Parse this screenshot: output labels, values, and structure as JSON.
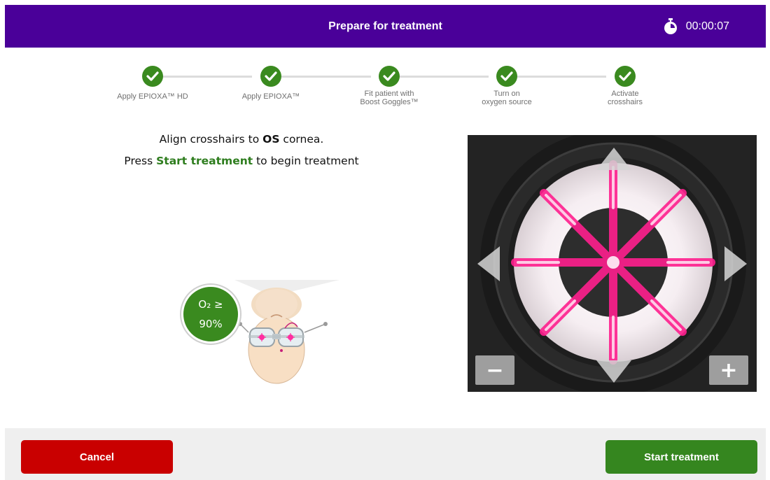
{
  "header": {
    "title": "Prepare for treatment",
    "timer": "00:00:07",
    "timer_icon": "stopwatch-icon",
    "background": "#4a0099"
  },
  "steps": [
    {
      "label_line1": "Apply EPIOXA™ HD",
      "label_line2": "",
      "status": "complete"
    },
    {
      "label_line1": "Apply EPIOXA™",
      "label_line2": "",
      "status": "complete"
    },
    {
      "label_line1": "Fit patient with",
      "label_line2": "Boost Goggles™",
      "status": "complete"
    },
    {
      "label_line1": "Turn on",
      "label_line2": "oxygen source",
      "status": "complete"
    },
    {
      "label_line1": "Activate",
      "label_line2": "crosshairs",
      "status": "complete"
    }
  ],
  "instructions": {
    "line1_pre": "Align crosshairs to ",
    "line1_bold": "OS",
    "line1_post": " cornea.",
    "line2_pre": "Press ",
    "line2_highlight": "Start treatment",
    "line2_post": " to begin treatment"
  },
  "oxygen": {
    "line1": "O₂ ≥",
    "line2": "90%"
  },
  "camera": {
    "zoom_out_label": "−",
    "zoom_in_label": "+",
    "crosshair_color": "#ff1f8e"
  },
  "footer": {
    "cancel_label": "Cancel",
    "start_label": "Start treatment"
  },
  "colors": {
    "accent_green": "#35861f",
    "cancel_red": "#c90000",
    "step_green": "#3a8a1f"
  }
}
